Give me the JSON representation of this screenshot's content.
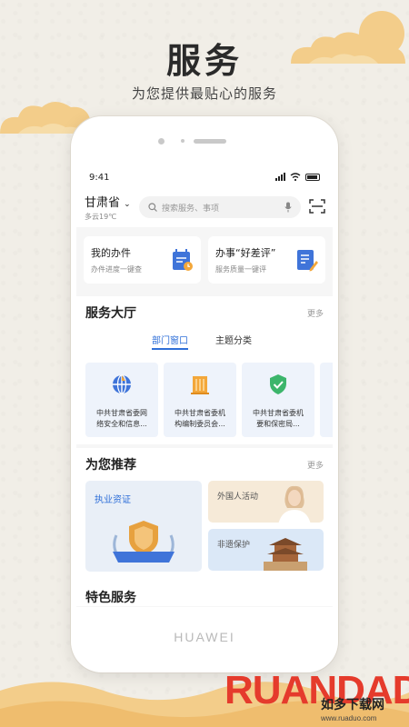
{
  "promo": {
    "headline": "服务",
    "subheadline": "为您提供最贴心的服务"
  },
  "phone": {
    "brand": "HUAWEI",
    "status_bar": {
      "time": "9:41"
    }
  },
  "header": {
    "city": "甘肃省",
    "weather": "多云19℃",
    "search_placeholder": "搜索服务、事项"
  },
  "quick_cards": [
    {
      "title": "我的办件",
      "subtitle": "办件进度一键查"
    },
    {
      "title": "办事“好差评”",
      "subtitle": "服务质量一键评"
    }
  ],
  "service_hall": {
    "title": "服务大厅",
    "more": "更多",
    "tabs": [
      "部门窗口",
      "主题分类"
    ],
    "cards": [
      {
        "line1": "中共甘肃省委网",
        "line2": "络安全和信息..."
      },
      {
        "line1": "中共甘肃省委机",
        "line2": "构编制委员会..."
      },
      {
        "line1": "中共甘肃省委机",
        "line2": "要和保密局..."
      }
    ]
  },
  "recommend": {
    "title": "为您推荐",
    "more": "更多",
    "big_card": "执业资证",
    "cards": [
      "外国人活动",
      "非遗保护"
    ]
  },
  "featured": {
    "title": "特色服务"
  },
  "watermark": {
    "text": "RUANDADO",
    "sub": "如多下载网",
    "url": "www.ruaduo.com"
  },
  "colors": {
    "accent": "#2f6fd8",
    "background": "#f1eee7",
    "cloud": "#f3cd8a"
  }
}
